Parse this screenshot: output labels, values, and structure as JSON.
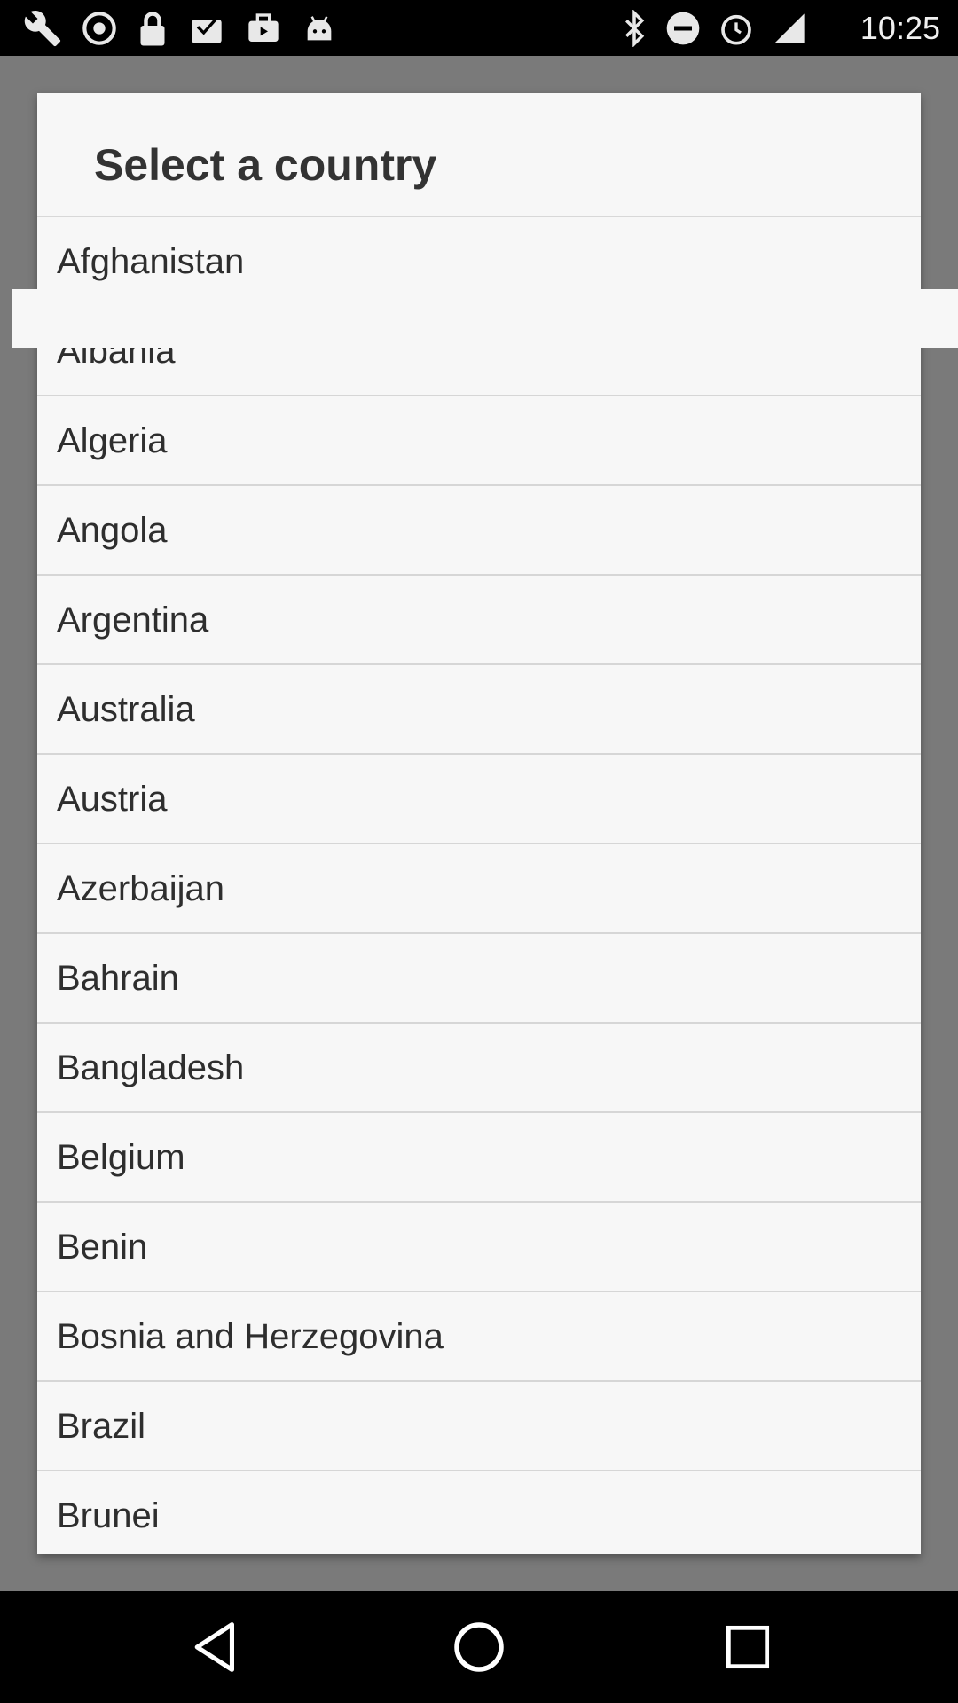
{
  "status_bar": {
    "time": "10:25",
    "left_icons": [
      "wrench-icon",
      "sync-icon",
      "lock-icon",
      "inbox-icon",
      "briefcase-icon",
      "android-icon"
    ],
    "right_icons": [
      "bluetooth-icon",
      "do-not-disturb-icon",
      "alarm-icon",
      "signal-icon"
    ]
  },
  "dialog": {
    "title": "Select a country",
    "countries": [
      "Afghanistan",
      "Albania",
      "Algeria",
      "Angola",
      "Argentina",
      "Australia",
      "Austria",
      "Azerbaijan",
      "Bahrain",
      "Bangladesh",
      "Belgium",
      "Benin",
      "Bosnia and Herzegovina",
      "Brazil",
      "Brunei"
    ]
  },
  "nav_bar": {
    "buttons": [
      "back-icon",
      "home-icon",
      "recents-icon"
    ]
  },
  "colors": {
    "scrim": "#7a7a7a",
    "dialog_background": "#f7f7f7",
    "divider": "#d6d6d6",
    "text": "#2e2e2e"
  }
}
